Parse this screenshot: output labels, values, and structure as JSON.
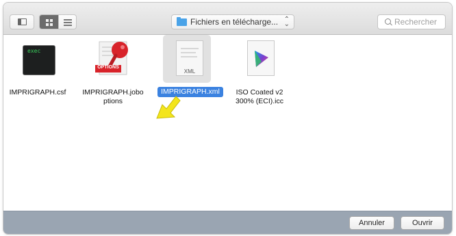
{
  "toolbar": {
    "path_label": "Fichiers en télécharge...",
    "search_placeholder": "Rechercher"
  },
  "files": [
    {
      "name": "IMPRIGRAPH.csf",
      "icon": "terminal-exec-icon",
      "icon_text": "exec"
    },
    {
      "name": "IMPRIGRAPH.joboptions",
      "name_line1": "IMPRIGRAPH.jobo",
      "name_line2": "ptions",
      "icon": "joboptions-pin-icon",
      "badge": "OPTIONS"
    },
    {
      "name": "IMPRIGRAPH.xml",
      "icon": "xml-document-icon",
      "icon_text": "XML",
      "selected": true
    },
    {
      "name": "ISO Coated v2 300% (ECI).icc",
      "name_line1": "ISO Coated v2",
      "name_line2": "300% (ECI).icc",
      "icon": "color-profile-icon"
    }
  ],
  "buttons": {
    "cancel": "Annuler",
    "open": "Ouvrir"
  },
  "colors": {
    "selection": "#3b82e0",
    "folder": "#4aa3e8",
    "bottom_bar": "#9aa5b2",
    "arrow": "#f3e51c"
  }
}
